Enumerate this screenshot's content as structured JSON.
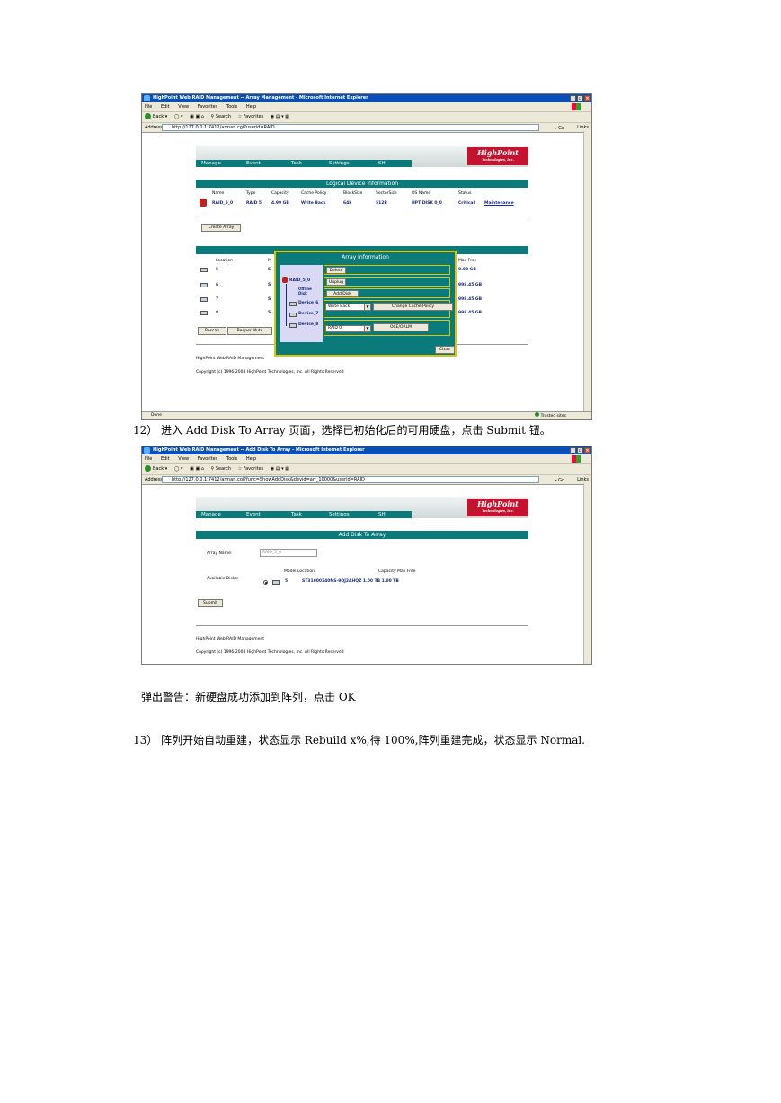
{
  "screenshot1": {
    "window_title": "HighPoint Web RAID Management -- Array Management - Microsoft Internet Explorer",
    "menu": [
      "File",
      "Edit",
      "View",
      "Favorites",
      "Tools",
      "Help"
    ],
    "toolbar": {
      "back": "Back",
      "search": "Search",
      "favorites": "Favorites"
    },
    "address_label": "Address",
    "url": "http://127.0.0.1:7412/arman.cgi?userid=RAID",
    "go": "Go",
    "links": "Links",
    "nav": [
      "Manage",
      "Event",
      "Task",
      "Settings",
      "SHI"
    ],
    "logo": "HighPoint",
    "logo_sub": "Technologies, Inc.",
    "logical_title": "Logical Device Information",
    "logical_headers": [
      "Name",
      "Type",
      "Capacity",
      "Cache Policy",
      "BlockSize",
      "SectorSize",
      "OS Name",
      "Status"
    ],
    "logical_row": [
      "RAID_5_0",
      "RAID 5",
      "4.99 GB",
      "Write Back",
      "64k",
      "512B",
      "HPT DISK 0_0",
      "Critical"
    ],
    "maintenance_link": "Maintenance",
    "create_array": "Create Array",
    "physical_headers": {
      "location": "Location",
      "model_partial": "M",
      "max_free": "Max Free"
    },
    "physical_rows": [
      {
        "location": "5",
        "model_partial": "S",
        "max_free": "0.00 GB"
      },
      {
        "location": "6",
        "model_partial": "S",
        "max_free": "998.45 GB"
      },
      {
        "location": "7",
        "model_partial": "S",
        "max_free": "998.45 GB"
      },
      {
        "location": "8",
        "model_partial": "S",
        "max_free": "998.45 GB"
      }
    ],
    "rescan": "Rescan",
    "beeper_mute": "Beeper Mute",
    "footer1": "HighPoint Web RAID Management",
    "footer2": "Copyright (c) 1996-2008 HighPoint Technologies, Inc. All Rights Reserved",
    "status_done": "Done",
    "status_trusted": "Trusted sites",
    "popup": {
      "title": "Array Information",
      "tree_root": "RAID_5_0",
      "offline_disk": "Offline Disk",
      "devices": [
        "Device_6",
        "Device_7",
        "Device_8"
      ],
      "delete": "Delete",
      "unplug": "Unplug",
      "add_disk": "Add Disk",
      "cache_select": "Write Back",
      "change_cache": "Change Cache Policy",
      "raid_select": "RAID 0",
      "oce": "OCE/ORLM",
      "close": "Close"
    }
  },
  "caption12": "12） 进入 Add Disk To Array  页面，选择已初始化后的可用硬盘，点击 Submit 钮。",
  "screenshot2": {
    "window_title": "HighPoint Web RAID Management -- Add Disk To Array - Microsoft Internet Explorer",
    "menu": [
      "File",
      "Edit",
      "View",
      "Favorites",
      "Tools",
      "Help"
    ],
    "toolbar": {
      "back": "Back",
      "search": "Search",
      "favorites": "Favorites"
    },
    "address_label": "Address",
    "url": "http://127.0.0.1:7412/arman.cgi?func=ShowAddDisk&devid=arr_10000&userid=RAID",
    "go": "Go",
    "links": "Links",
    "nav": [
      "Manage",
      "Event",
      "Task",
      "Settings",
      "SHI"
    ],
    "logo": "HighPoint",
    "logo_sub": "Technologies, Inc.",
    "section_title": "Add Disk To Array",
    "array_name_label": "Array Name:",
    "array_name_value": "RAID_5_0",
    "col_headers": "Model Location",
    "col_headers2": "Capacity Max Free",
    "available_label": "Available Disks:",
    "disk_location": "5",
    "disk_row": "ST31000340NS-9QJ2AHQZ 1.00 TB  1.00 TB",
    "submit": "Submit",
    "footer1": "HighPoint Web RAID Management",
    "footer2": "Copyright (c) 1996-2008 HighPoint Technologies, Inc. All Rights Reserved"
  },
  "warning_text": "弹出警告：新硬盘成功添加到阵列，点击 OK",
  "caption13": "13） 阵列开始自动重建，状态显示 Rebuild x%,待 100%,阵列重建完成，状态显示 Normal."
}
